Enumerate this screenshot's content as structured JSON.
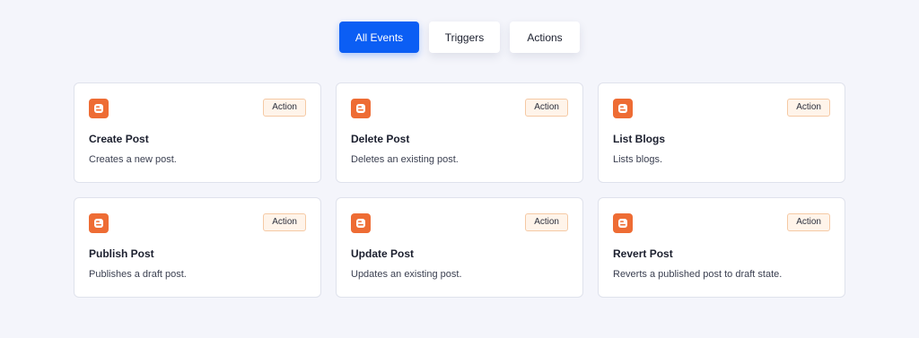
{
  "tabs": [
    {
      "label": "All Events",
      "active": true
    },
    {
      "label": "Triggers",
      "active": false
    },
    {
      "label": "Actions",
      "active": false
    }
  ],
  "colors": {
    "accent": "#0b5ef4",
    "brand_logo": "#ee6c34",
    "badge_bg": "#fff4ea",
    "badge_border": "#f5c9a4"
  },
  "cards": [
    {
      "icon": "blogger-icon",
      "badge": "Action",
      "title": "Create Post",
      "description": "Creates a new post."
    },
    {
      "icon": "blogger-icon",
      "badge": "Action",
      "title": "Delete Post",
      "description": "Deletes an existing post."
    },
    {
      "icon": "blogger-icon",
      "badge": "Action",
      "title": "List Blogs",
      "description": "Lists blogs."
    },
    {
      "icon": "blogger-icon",
      "badge": "Action",
      "title": "Publish Post",
      "description": "Publishes a draft post."
    },
    {
      "icon": "blogger-icon",
      "badge": "Action",
      "title": "Update Post",
      "description": "Updates an existing post."
    },
    {
      "icon": "blogger-icon",
      "badge": "Action",
      "title": "Revert Post",
      "description": "Reverts a published post to draft state."
    }
  ]
}
